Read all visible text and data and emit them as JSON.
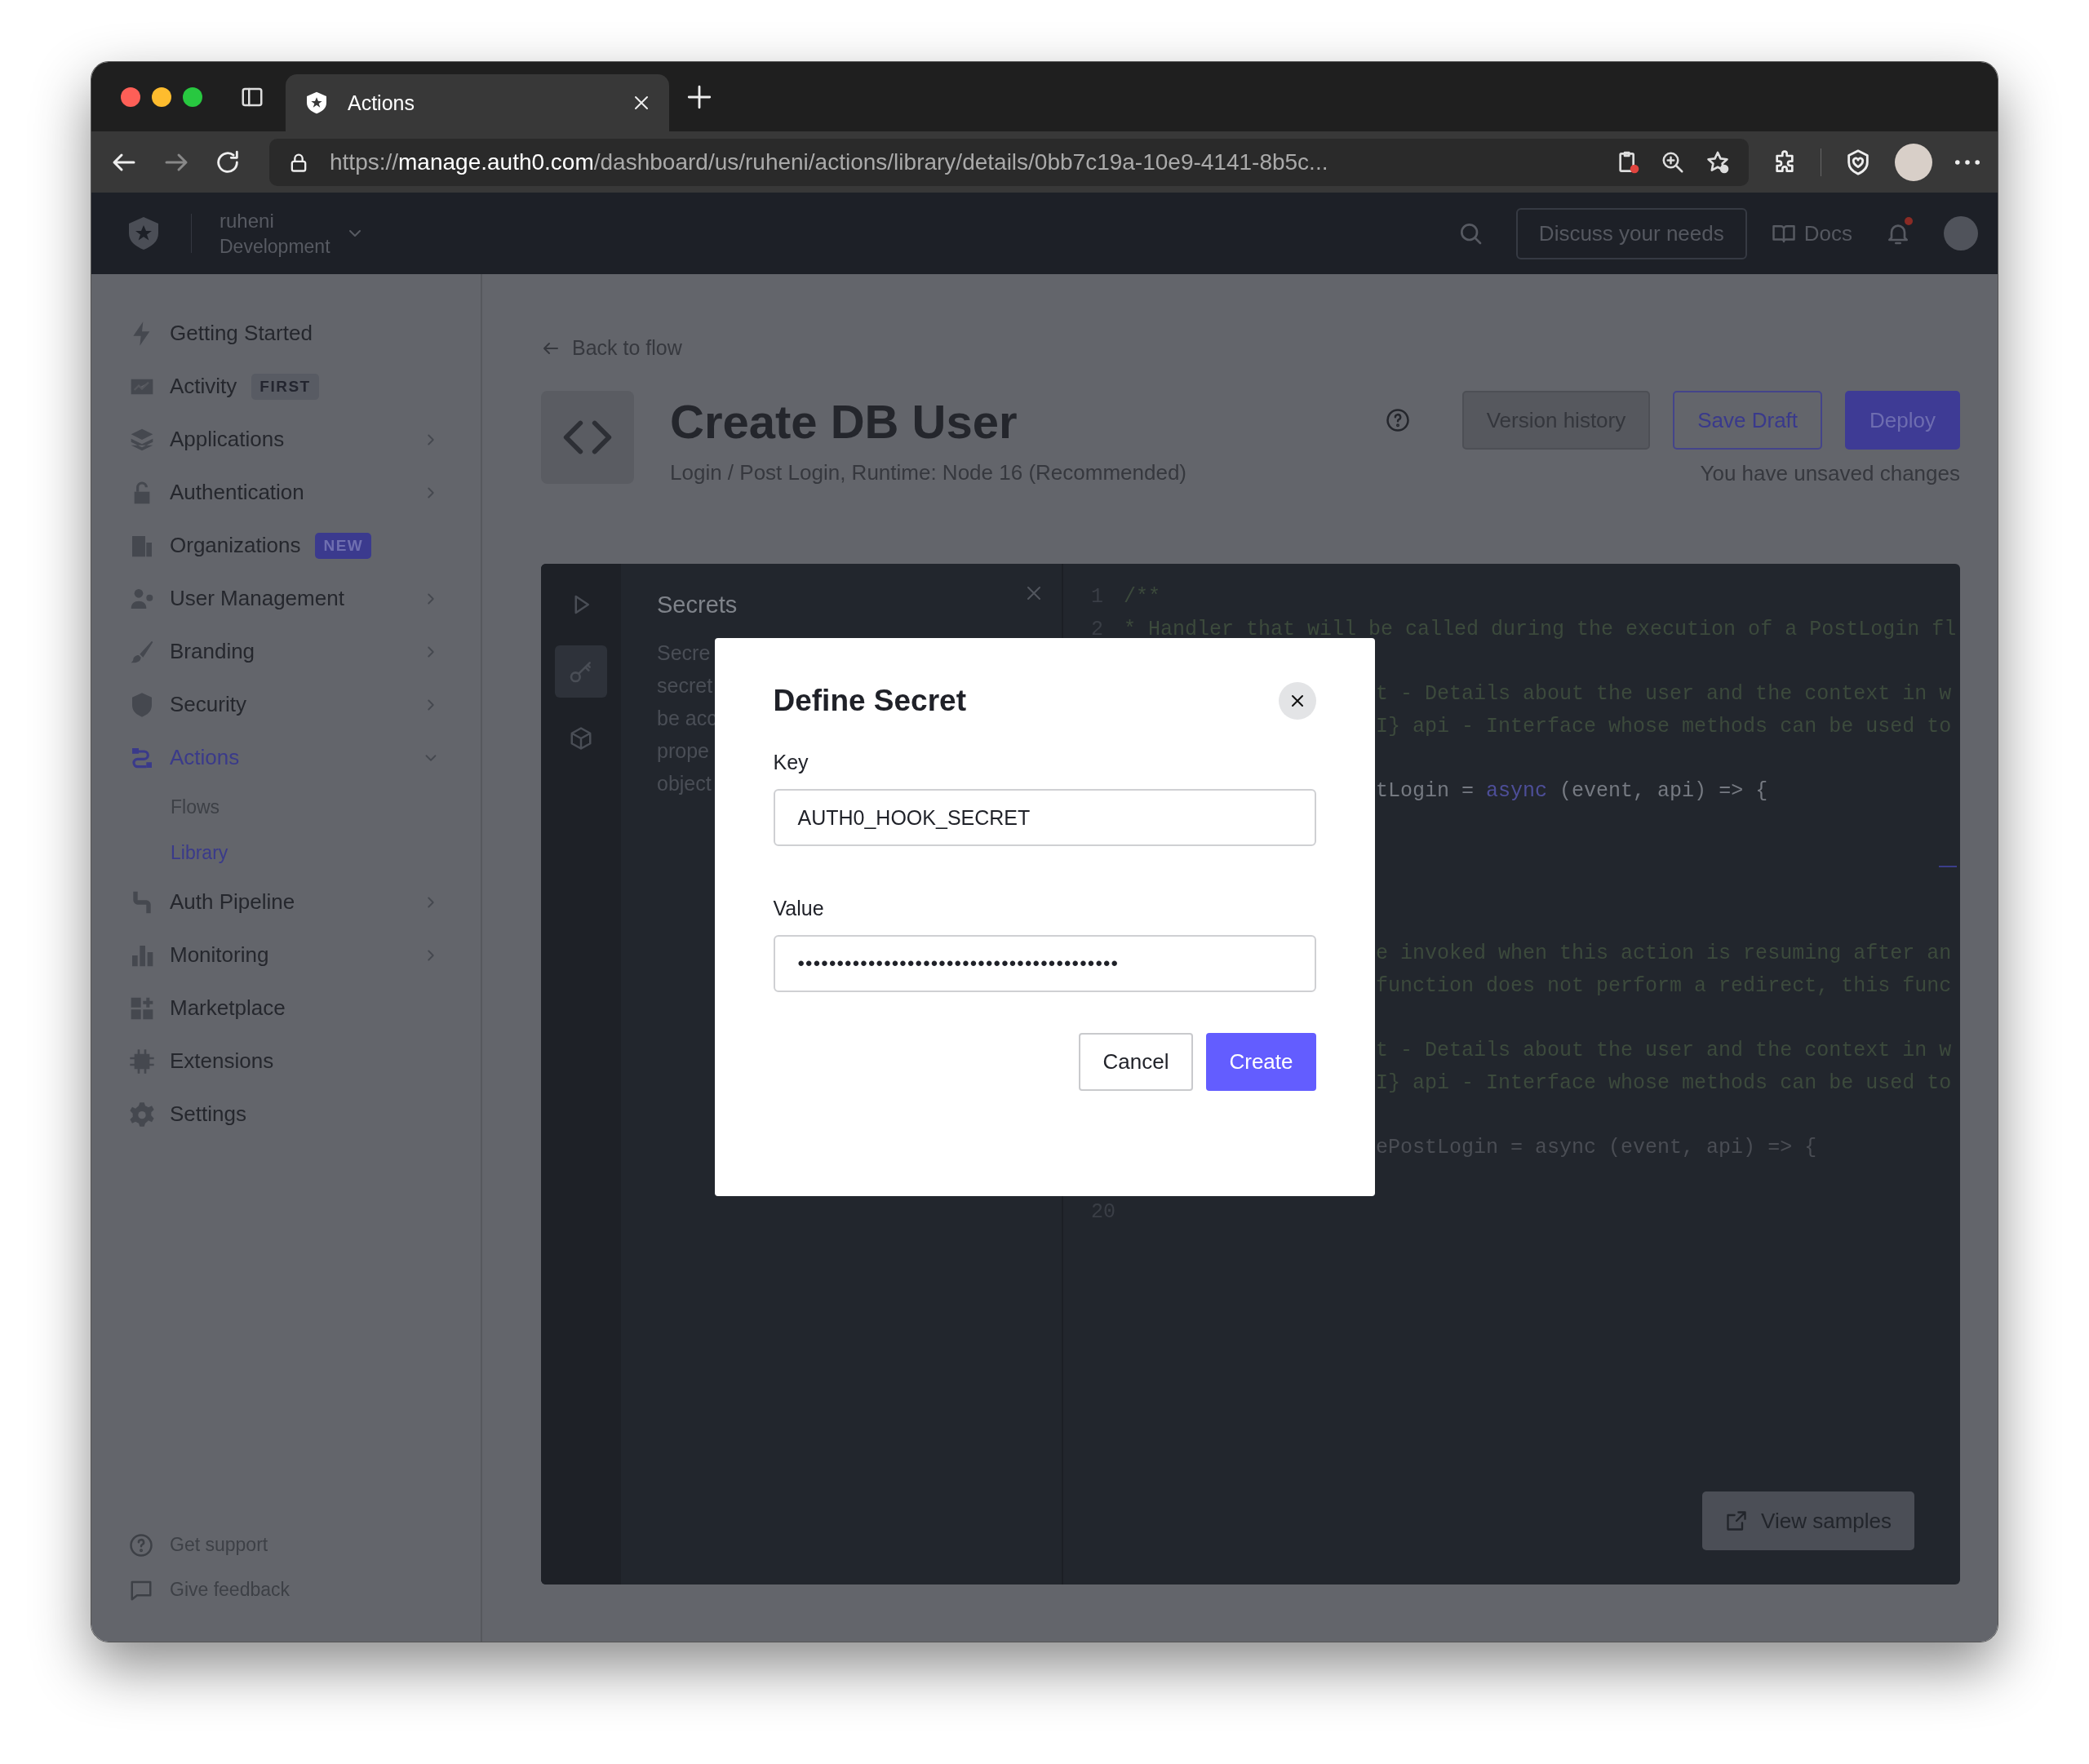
{
  "browser": {
    "tab": {
      "title": "Actions"
    },
    "url": {
      "scheme": "https://",
      "host": "manage.auth0.com",
      "path": "/dashboard/us/ruheni/actions/library/details/0bb7c19a-10e9-4141-8b5c..."
    }
  },
  "header": {
    "tenant": "ruheni",
    "environment": "Development",
    "cta": "Discuss your needs",
    "docs": "Docs",
    "notification": true
  },
  "sidebar": {
    "items": [
      {
        "label": "Getting Started",
        "selected": false
      },
      {
        "label": "Activity",
        "selected": false,
        "badge": {
          "text": "FIRST",
          "kind": "neutral"
        }
      },
      {
        "label": "Applications",
        "selected": false,
        "expanded": false
      },
      {
        "label": "Authentication",
        "selected": false,
        "expanded": false
      },
      {
        "label": "Organizations",
        "selected": false,
        "badge": {
          "text": "NEW",
          "kind": "highlight"
        }
      },
      {
        "label": "User Management",
        "selected": false,
        "expanded": false
      },
      {
        "label": "Branding",
        "selected": false,
        "expanded": false
      },
      {
        "label": "Security",
        "selected": false,
        "expanded": false
      },
      {
        "label": "Actions",
        "selected": true,
        "expanded": true,
        "children": [
          {
            "label": "Flows",
            "selected": false
          },
          {
            "label": "Library",
            "selected": true
          }
        ]
      },
      {
        "label": "Auth Pipeline",
        "selected": false,
        "expanded": false
      },
      {
        "label": "Monitoring",
        "selected": false,
        "expanded": false
      },
      {
        "label": "Marketplace",
        "selected": false
      },
      {
        "label": "Extensions",
        "selected": false
      },
      {
        "label": "Settings",
        "selected": false
      }
    ],
    "footer": [
      {
        "label": "Get support"
      },
      {
        "label": "Give feedback"
      }
    ]
  },
  "page": {
    "back_link": "Back to flow",
    "title": "Create DB User",
    "subtitle": "Login / Post Login, Runtime: Node 16 (Recommended)",
    "buttons": [
      {
        "label": "Version history",
        "kind": "secondary"
      },
      {
        "label": "Save Draft",
        "kind": "outline"
      },
      {
        "label": "Deploy",
        "kind": "primary"
      }
    ],
    "status": "You have unsaved changes"
  },
  "editor": {
    "rail": [
      {
        "selected": false
      },
      {
        "selected": true
      },
      {
        "selected": false
      }
    ],
    "panel": {
      "title": "Secrets",
      "description_lines": [
        "Secre",
        "secret",
        "be acc",
        "prope",
        "object"
      ]
    },
    "code_lines": [
      {
        "kind": "numbered",
        "number": "1",
        "segments": [
          {
            "text": "/**",
            "kind": "comment"
          }
        ]
      },
      {
        "kind": "numbered",
        "number": "2",
        "segments": [
          {
            "text": "* Handler that will be called during the execution of a PostLogin fl",
            "kind": "comment"
          }
        ]
      },
      {
        "kind": "blank"
      },
      {
        "kind": "covered",
        "segments": [
          {
            "text": "t - Details about the user and the context in w",
            "kind": "comment"
          }
        ]
      },
      {
        "kind": "covered",
        "segments": [
          {
            "text": "I} api - Interface whose methods can be used to",
            "kind": "comment"
          }
        ]
      },
      {
        "kind": "blank"
      },
      {
        "kind": "covered",
        "segments": [
          {
            "text": "tLogin = ",
            "kind": "code"
          },
          {
            "text": "async",
            "kind": "keyword"
          },
          {
            "text": " (event, api) => {",
            "kind": "code"
          }
        ]
      },
      {
        "kind": "blank"
      },
      {
        "kind": "blank"
      },
      {
        "kind": "blank"
      },
      {
        "kind": "blank"
      },
      {
        "kind": "covered",
        "segments": [
          {
            "text": "e invoked when this action is resuming after an",
            "kind": "comment"
          }
        ]
      },
      {
        "kind": "covered",
        "segments": [
          {
            "text": "function does not perform a redirect, this func",
            "kind": "comment"
          }
        ]
      },
      {
        "kind": "blank"
      },
      {
        "kind": "covered",
        "segments": [
          {
            "text": "t - Details about the user and the context in w",
            "kind": "comment"
          }
        ]
      },
      {
        "kind": "covered",
        "segments": [
          {
            "text": "I} api - Interface whose methods can be used to",
            "kind": "comment"
          }
        ]
      },
      {
        "kind": "blank"
      },
      {
        "kind": "covered",
        "segments": [
          {
            "text": "ePostLogin = async (event, api) => {",
            "kind": "dim"
          }
        ]
      },
      {
        "kind": "blank"
      },
      {
        "kind": "numbered",
        "number": "20"
      }
    ],
    "samples_button": "View samples"
  },
  "dialog": {
    "title": "Define Secret",
    "fields": [
      {
        "label": "Key",
        "value": "AUTH0_HOOK_SECRET",
        "kind": "text"
      },
      {
        "label": "Value",
        "value": "•••••••••••••••••••••••••••••••••••••••••",
        "kind": "secret"
      }
    ],
    "buttons": [
      {
        "label": "Cancel",
        "kind": "secondary"
      },
      {
        "label": "Create",
        "kind": "primary"
      }
    ]
  }
}
